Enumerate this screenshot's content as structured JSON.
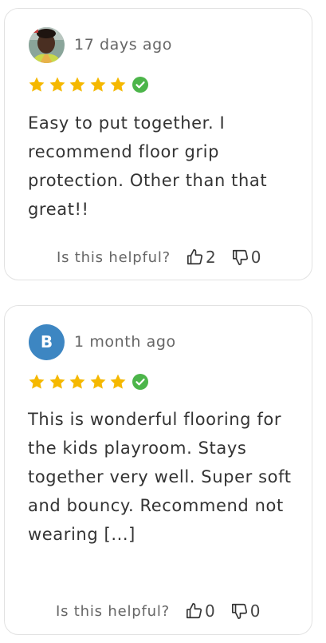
{
  "reviews": [
    {
      "time": "17 days ago",
      "rating": 5,
      "text": "Easy to put together. I recommend floor grip protection. Other than that great!!",
      "helpful_label": "Is this helpful?",
      "thumbs_up": "2",
      "thumbs_down": "0",
      "avatar": "photo-avatar"
    },
    {
      "time": "1 month ago",
      "rating": 5,
      "avatar_letter": "B",
      "text": "This is wonderful flooring for the kids playroom. Stays together very well. Super soft and bouncy. Recommend not wearing [...]",
      "helpful_label": "Is this helpful?",
      "thumbs_up": "0",
      "thumbs_down": "0"
    }
  ],
  "colors": {
    "star": "#f5b800",
    "verified": "#4cb54a",
    "avatar_b": "#3d86c2",
    "border": "#e2e2e2"
  },
  "icons": [
    "star-icon",
    "verified-check-icon",
    "thumbs-up-icon",
    "thumbs-down-icon"
  ]
}
